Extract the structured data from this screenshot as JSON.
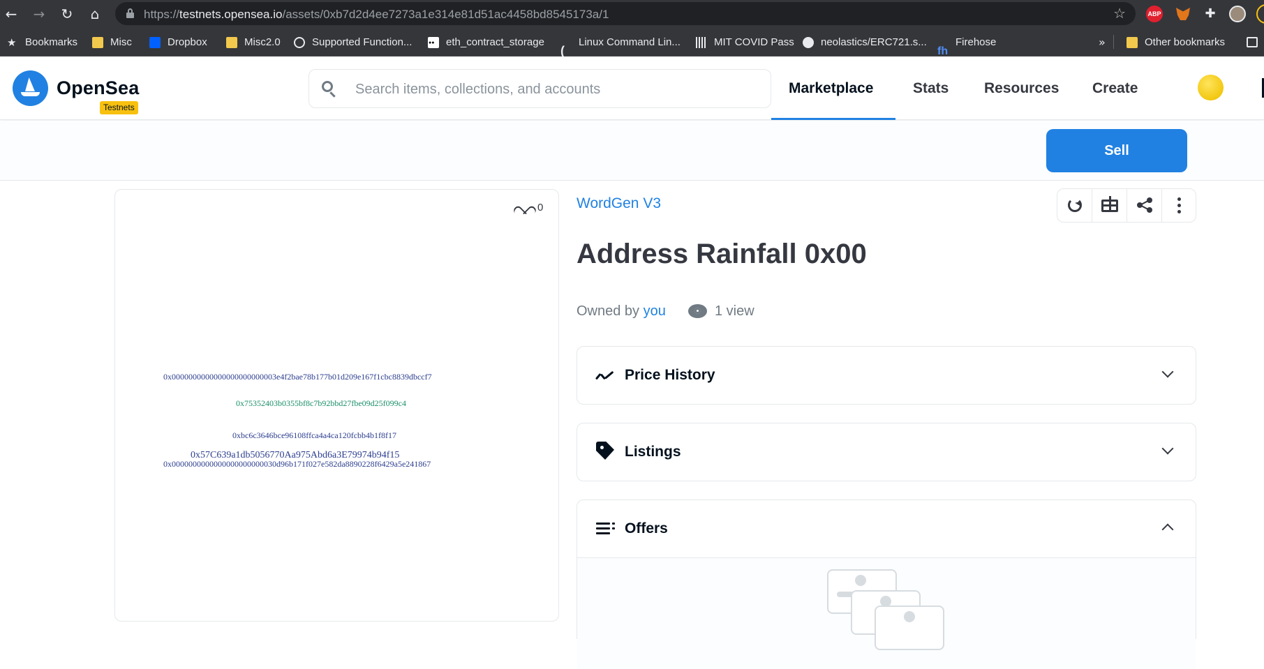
{
  "browser": {
    "url_prefix": "https://",
    "url_host": "testnets.opensea.io",
    "url_path": "/assets/0xb7d2d4ee7273a1e314e81d51ac4458bd8545173a/1",
    "extensions": {
      "abp_label": "ABP"
    },
    "bookmarks": [
      {
        "label": "Bookmarks",
        "icon": "star-icon"
      },
      {
        "label": "Misc",
        "icon": "folder-icon"
      },
      {
        "label": "Dropbox",
        "icon": "dropbox-icon"
      },
      {
        "label": "Misc2.0",
        "icon": "folder-icon"
      },
      {
        "label": "Supported Function...",
        "icon": "globe-icon"
      },
      {
        "label": "eth_contract_storage",
        "icon": "medium-icon"
      },
      {
        "label": "Linux Command Lin...",
        "icon": "paren-icon"
      },
      {
        "label": "MIT COVID Pass",
        "icon": "mit-icon"
      },
      {
        "label": "neolastics/ERC721.s...",
        "icon": "github-icon"
      },
      {
        "label": "Firehose",
        "icon": "fh-icon"
      }
    ],
    "more_bookmarks": "»",
    "other_bookmarks": "Other bookmarks"
  },
  "header": {
    "logo_text": "OpenSea",
    "badge": "Testnets",
    "search_placeholder": "Search items, collections, and accounts",
    "nav": [
      {
        "label": "Marketplace",
        "active": true
      },
      {
        "label": "Stats",
        "active": false
      },
      {
        "label": "Resources",
        "active": false
      },
      {
        "label": "Create",
        "active": false
      }
    ]
  },
  "sell_label": "Sell",
  "asset": {
    "favorites": "0",
    "image_lines": [
      {
        "text": "0x0000000000000000000000003e4f2bae78b177b01d209e167f1cbc8839dbccf7",
        "color": "#2c3e8f"
      },
      {
        "text": "0x75352403b0355bf8c7b92bbd27fbe09d25f099c4",
        "color": "#1a8f6a"
      },
      {
        "text": "0xbc6c3646bce96108ffca4a4ca120fcbb4b1f8f17",
        "color": "#2c3e8f"
      },
      {
        "text": "0x57C639a1db5056770Aa975Abd6a3E79974b94f15",
        "color": "#2c3e8f"
      },
      {
        "text": "0x0000000000000000000000030d96b171f027e582da8890228f6429a5e241867",
        "color": "#2c3e8f"
      }
    ],
    "collection": "WordGen V3",
    "title": "Address Rainfall 0x00",
    "owned_by": "Owned by",
    "owner": "you",
    "views": "1 view"
  },
  "panels": {
    "price_history": "Price History",
    "listings": "Listings",
    "offers": "Offers"
  },
  "colors": {
    "brand": "#2081e2",
    "badge": "#f8c10f"
  }
}
